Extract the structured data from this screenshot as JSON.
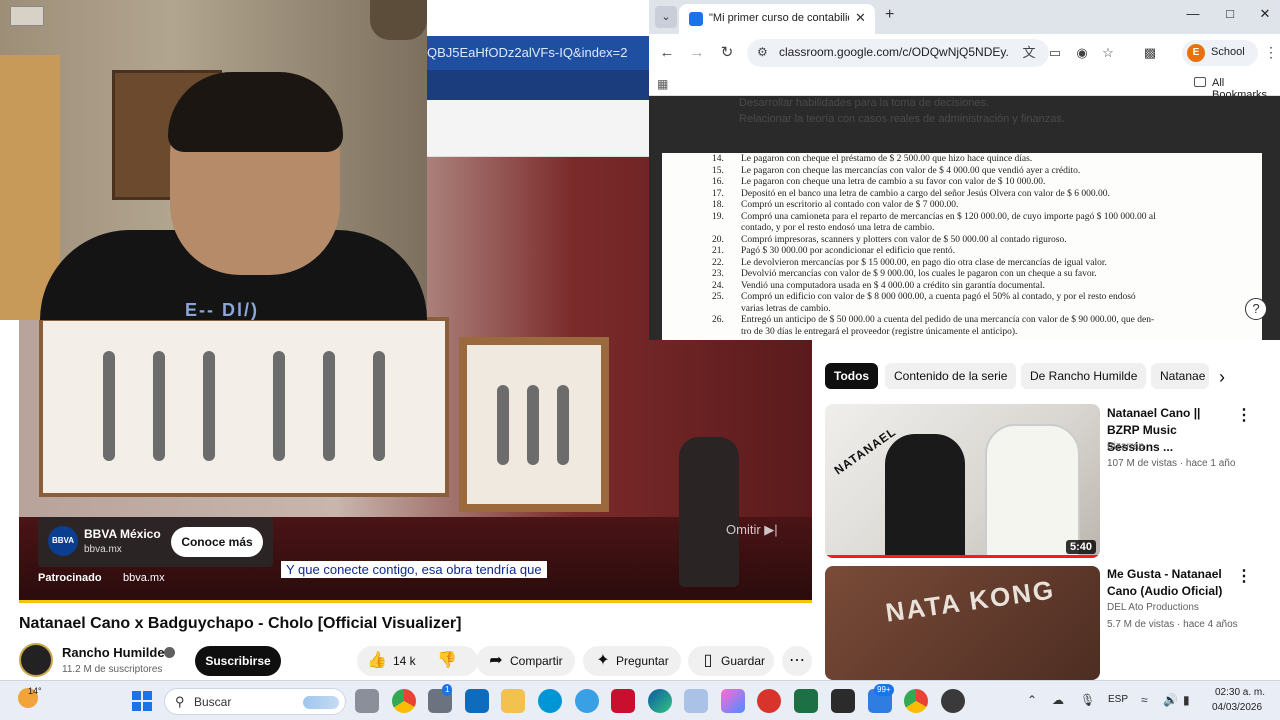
{
  "youtube": {
    "url_fragment": "QBJ5EaHfODz2alVFs-IQ&index=2",
    "ad": {
      "brand": "BBVA México",
      "logo_text": "BBVA",
      "url": "bbva.mx",
      "cta": "Conoce más",
      "sponsored_label": "Patrocinado",
      "sponsored_url": "bbva.mx",
      "skip_label": "Omitir ▶|"
    },
    "caption": "Y que conecte contigo, esa obra tendría que",
    "video_title": "Natanael Cano x Badguychapo - Cholo [Official Visualizer]",
    "channel": {
      "name": "Rancho Humilde",
      "subscribers": "11.2 M de suscriptores",
      "subscribe_label": "Suscribirse"
    },
    "actions": {
      "likes": "14 k",
      "share": "Compartir",
      "ask": "Preguntar",
      "save": "Guardar"
    },
    "chips": [
      "Todos",
      "Contenido de la serie",
      "De Rancho Humilde",
      "Natanae"
    ],
    "suggestions": [
      {
        "title": "Natanael Cano || BZRP Music Sessions ...",
        "channel": "Bizarrap",
        "meta": "107 M de vistas · hace 1 año",
        "duration": "5:40",
        "thumb_text": "NATANAEL"
      },
      {
        "title": "Me Gusta - Natanael Cano (Audio Oficial)",
        "channel": "DEL Ato Productions",
        "meta": "5.7 M de vistas · hace 4 años",
        "thumb_text": "NATA KONG"
      }
    ]
  },
  "webcam": {
    "shirt_print": "E-- Dl/)"
  },
  "chrome": {
    "tab_title": "\"Mi primer curso de contabilida",
    "url": "classroom.google.com/c/ODQwNjQ5NDEy...",
    "profile_initial": "E",
    "profile_label": "School",
    "bookmarks_label": "All Bookmarks",
    "bullets": [
      "Desarrollar habilidades para la toma de decisiones.",
      "Relacionar la teoría con casos reales de administración y finanzas."
    ],
    "document_items": [
      {
        "num": "14.",
        "text": "Le pagaron con cheque el préstamo de $ 2 500.00 que hizo hace quince días."
      },
      {
        "num": "15.",
        "text": "Le pagaron con cheque las mercancías con valor de $ 4 000.00 que vendió ayer a crédito."
      },
      {
        "num": "16.",
        "text": "Le pagaron con cheque una letra de cambio a su favor con valor de $ 10 000.00."
      },
      {
        "num": "17.",
        "text": "Depositó en el banco una letra de cambio a cargo del señor Jesús Olvera con valor de $ 6 000.00."
      },
      {
        "num": "18.",
        "text": "Compró un escritorio al contado con valor de $ 7 000.00."
      },
      {
        "num": "19.",
        "text": "Compró una camioneta para el reparto de mercancías en $ 120 000.00, de cuyo importe pagó $ 100 000.00 al"
      },
      {
        "num": "",
        "text": "contado, y por el resto endosó una letra de cambio."
      },
      {
        "num": "20.",
        "text": "Compró impresoras, scanners y plotters con valor de $ 50 000.00 al contado riguroso."
      },
      {
        "num": "21.",
        "text": "Pagó $ 30 000.00 por acondicionar el edificio que rentó."
      },
      {
        "num": "22.",
        "text": "Le devolvieron mercancías por $ 15 000.00, en pago dio otra clase de mercancías de igual valor."
      },
      {
        "num": "23.",
        "text": "Devolvió mercancías con valor de $ 9 000.00, los cuales le pagaron con un cheque a su favor."
      },
      {
        "num": "24.",
        "text": "Vendió una computadora usada en $ 4 000.00 a crédito sin garantía documental."
      },
      {
        "num": "25.",
        "text": "Compró un edificio con valor de $ 8 000 000.00, a cuenta pagó el 50% al contado, y por el resto endosó"
      },
      {
        "num": "",
        "text": "varias letras de cambio."
      },
      {
        "num": "26.",
        "text": "Entregó un anticipo de $ 50 000.00 a cuenta del pedido de una mercancía con valor de $ 90 000.00, que den-"
      },
      {
        "num": "",
        "text": "tro de 30 días le entregará el proveedor (registre únicamente el anticipo)."
      }
    ]
  },
  "taskbar": {
    "temperature": "14°",
    "search_placeholder": "Buscar",
    "notification_badge": "99+",
    "language": "ESP",
    "time": "02:30 a. m.",
    "date": "04/03/2026"
  },
  "colors": {
    "youtube_progress": "#f5c300",
    "chrome_blue": "#1a73e8",
    "ad_logo": "#0b3d91"
  }
}
